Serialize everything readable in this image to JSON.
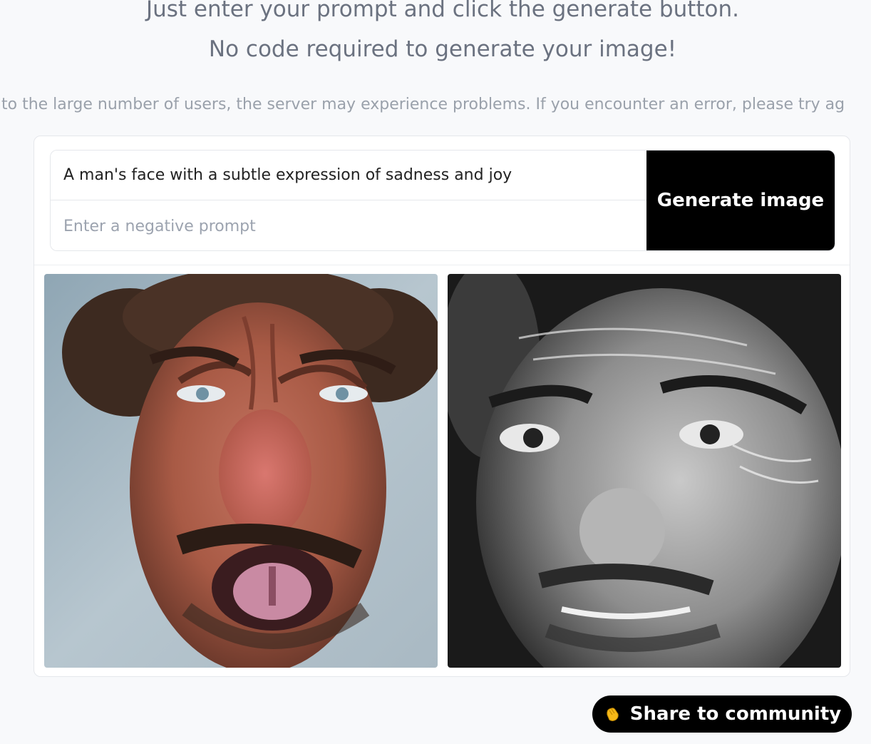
{
  "header": {
    "line1": "Just enter your prompt and click the generate button.",
    "line2": "No code required to generate your image!"
  },
  "notice": "to the large number of users, the server may experience problems. If you encounter an error, please try ag",
  "form": {
    "prompt_value": "A man's face with a subtle expression of sadness and joy",
    "negative_placeholder": "Enter a negative prompt",
    "generate_label": "Generate image"
  },
  "gallery": {
    "images": [
      {
        "icon": "portrait-color-image"
      },
      {
        "icon": "portrait-bw-image"
      }
    ]
  },
  "share": {
    "label": "Share to community",
    "icon": "clapping-hands-icon"
  },
  "colors": {
    "background": "#f8f9fb",
    "button": "#000000",
    "button_text": "#ffffff",
    "muted_text": "#6b7280"
  }
}
